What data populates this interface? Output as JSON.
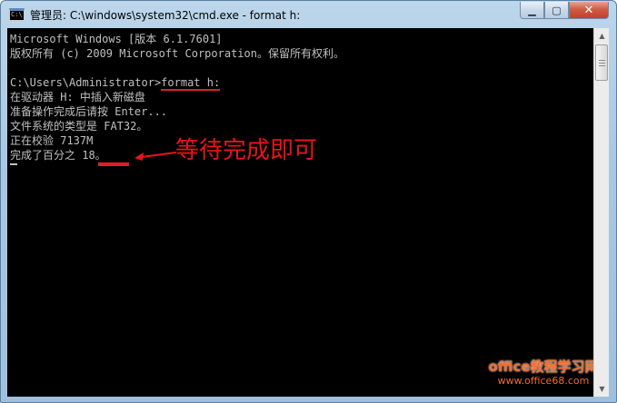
{
  "window": {
    "title": "管理员: C:\\windows\\system32\\cmd.exe - format  h:",
    "icon_label": "C:\\."
  },
  "controls": {
    "minimize": "▁",
    "maximize": "▢",
    "close": "✕"
  },
  "console": {
    "lines": [
      "Microsoft Windows [版本 6.1.7601]",
      "版权所有 (c) 2009 Microsoft Corporation。保留所有权利。",
      "",
      "C:\\Users\\Administrator>",
      "在驱动器 H: 中插入新磁盘",
      "准备操作完成后请按 Enter...",
      "文件系统的类型是 FAT32。",
      "正在校验 7137M",
      "完成了百分之 18。"
    ],
    "command": "format h:"
  },
  "annotation": {
    "text": "等待完成即可",
    "color": "#e8141b"
  },
  "watermark": {
    "title": "office教程学习网",
    "url": "www.office68.com"
  },
  "colors": {
    "console_bg": "#000000",
    "console_text": "#c0c0c0",
    "highlight_red": "#e02020"
  }
}
